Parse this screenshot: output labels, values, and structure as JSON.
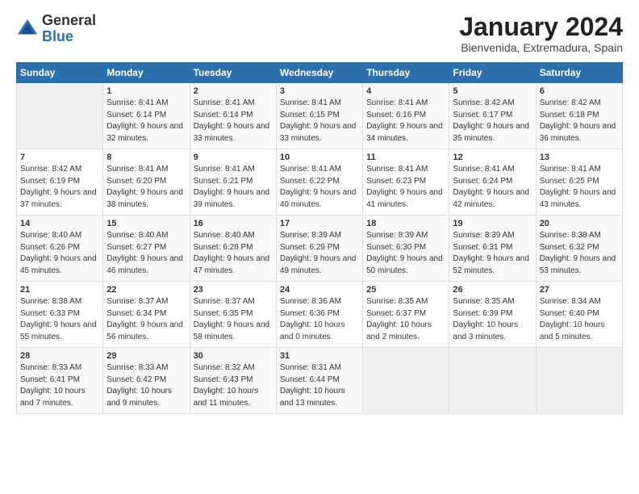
{
  "logo": {
    "general": "General",
    "blue": "Blue"
  },
  "header": {
    "title": "January 2024",
    "subtitle": "Bienvenida, Extremadura, Spain"
  },
  "days_of_week": [
    "Sunday",
    "Monday",
    "Tuesday",
    "Wednesday",
    "Thursday",
    "Friday",
    "Saturday"
  ],
  "weeks": [
    [
      {
        "day": "",
        "sunrise": "",
        "sunset": "",
        "daylight": ""
      },
      {
        "day": "1",
        "sunrise": "Sunrise: 8:41 AM",
        "sunset": "Sunset: 6:14 PM",
        "daylight": "Daylight: 9 hours and 32 minutes."
      },
      {
        "day": "2",
        "sunrise": "Sunrise: 8:41 AM",
        "sunset": "Sunset: 6:14 PM",
        "daylight": "Daylight: 9 hours and 33 minutes."
      },
      {
        "day": "3",
        "sunrise": "Sunrise: 8:41 AM",
        "sunset": "Sunset: 6:15 PM",
        "daylight": "Daylight: 9 hours and 33 minutes."
      },
      {
        "day": "4",
        "sunrise": "Sunrise: 8:41 AM",
        "sunset": "Sunset: 6:16 PM",
        "daylight": "Daylight: 9 hours and 34 minutes."
      },
      {
        "day": "5",
        "sunrise": "Sunrise: 8:42 AM",
        "sunset": "Sunset: 6:17 PM",
        "daylight": "Daylight: 9 hours and 35 minutes."
      },
      {
        "day": "6",
        "sunrise": "Sunrise: 8:42 AM",
        "sunset": "Sunset: 6:18 PM",
        "daylight": "Daylight: 9 hours and 36 minutes."
      }
    ],
    [
      {
        "day": "7",
        "sunrise": "Sunrise: 8:42 AM",
        "sunset": "Sunset: 6:19 PM",
        "daylight": "Daylight: 9 hours and 37 minutes."
      },
      {
        "day": "8",
        "sunrise": "Sunrise: 8:41 AM",
        "sunset": "Sunset: 6:20 PM",
        "daylight": "Daylight: 9 hours and 38 minutes."
      },
      {
        "day": "9",
        "sunrise": "Sunrise: 8:41 AM",
        "sunset": "Sunset: 6:21 PM",
        "daylight": "Daylight: 9 hours and 39 minutes."
      },
      {
        "day": "10",
        "sunrise": "Sunrise: 8:41 AM",
        "sunset": "Sunset: 6:22 PM",
        "daylight": "Daylight: 9 hours and 40 minutes."
      },
      {
        "day": "11",
        "sunrise": "Sunrise: 8:41 AM",
        "sunset": "Sunset: 6:23 PM",
        "daylight": "Daylight: 9 hours and 41 minutes."
      },
      {
        "day": "12",
        "sunrise": "Sunrise: 8:41 AM",
        "sunset": "Sunset: 6:24 PM",
        "daylight": "Daylight: 9 hours and 42 minutes."
      },
      {
        "day": "13",
        "sunrise": "Sunrise: 8:41 AM",
        "sunset": "Sunset: 6:25 PM",
        "daylight": "Daylight: 9 hours and 43 minutes."
      }
    ],
    [
      {
        "day": "14",
        "sunrise": "Sunrise: 8:40 AM",
        "sunset": "Sunset: 6:26 PM",
        "daylight": "Daylight: 9 hours and 45 minutes."
      },
      {
        "day": "15",
        "sunrise": "Sunrise: 8:40 AM",
        "sunset": "Sunset: 6:27 PM",
        "daylight": "Daylight: 9 hours and 46 minutes."
      },
      {
        "day": "16",
        "sunrise": "Sunrise: 8:40 AM",
        "sunset": "Sunset: 6:28 PM",
        "daylight": "Daylight: 9 hours and 47 minutes."
      },
      {
        "day": "17",
        "sunrise": "Sunrise: 8:39 AM",
        "sunset": "Sunset: 6:29 PM",
        "daylight": "Daylight: 9 hours and 49 minutes."
      },
      {
        "day": "18",
        "sunrise": "Sunrise: 8:39 AM",
        "sunset": "Sunset: 6:30 PM",
        "daylight": "Daylight: 9 hours and 50 minutes."
      },
      {
        "day": "19",
        "sunrise": "Sunrise: 8:39 AM",
        "sunset": "Sunset: 6:31 PM",
        "daylight": "Daylight: 9 hours and 52 minutes."
      },
      {
        "day": "20",
        "sunrise": "Sunrise: 8:38 AM",
        "sunset": "Sunset: 6:32 PM",
        "daylight": "Daylight: 9 hours and 53 minutes."
      }
    ],
    [
      {
        "day": "21",
        "sunrise": "Sunrise: 8:38 AM",
        "sunset": "Sunset: 6:33 PM",
        "daylight": "Daylight: 9 hours and 55 minutes."
      },
      {
        "day": "22",
        "sunrise": "Sunrise: 8:37 AM",
        "sunset": "Sunset: 6:34 PM",
        "daylight": "Daylight: 9 hours and 56 minutes."
      },
      {
        "day": "23",
        "sunrise": "Sunrise: 8:37 AM",
        "sunset": "Sunset: 6:35 PM",
        "daylight": "Daylight: 9 hours and 58 minutes."
      },
      {
        "day": "24",
        "sunrise": "Sunrise: 8:36 AM",
        "sunset": "Sunset: 6:36 PM",
        "daylight": "Daylight: 10 hours and 0 minutes."
      },
      {
        "day": "25",
        "sunrise": "Sunrise: 8:35 AM",
        "sunset": "Sunset: 6:37 PM",
        "daylight": "Daylight: 10 hours and 2 minutes."
      },
      {
        "day": "26",
        "sunrise": "Sunrise: 8:35 AM",
        "sunset": "Sunset: 6:39 PM",
        "daylight": "Daylight: 10 hours and 3 minutes."
      },
      {
        "day": "27",
        "sunrise": "Sunrise: 8:34 AM",
        "sunset": "Sunset: 6:40 PM",
        "daylight": "Daylight: 10 hours and 5 minutes."
      }
    ],
    [
      {
        "day": "28",
        "sunrise": "Sunrise: 8:33 AM",
        "sunset": "Sunset: 6:41 PM",
        "daylight": "Daylight: 10 hours and 7 minutes."
      },
      {
        "day": "29",
        "sunrise": "Sunrise: 8:33 AM",
        "sunset": "Sunset: 6:42 PM",
        "daylight": "Daylight: 10 hours and 9 minutes."
      },
      {
        "day": "30",
        "sunrise": "Sunrise: 8:32 AM",
        "sunset": "Sunset: 6:43 PM",
        "daylight": "Daylight: 10 hours and 11 minutes."
      },
      {
        "day": "31",
        "sunrise": "Sunrise: 8:31 AM",
        "sunset": "Sunset: 6:44 PM",
        "daylight": "Daylight: 10 hours and 13 minutes."
      },
      {
        "day": "",
        "sunrise": "",
        "sunset": "",
        "daylight": ""
      },
      {
        "day": "",
        "sunrise": "",
        "sunset": "",
        "daylight": ""
      },
      {
        "day": "",
        "sunrise": "",
        "sunset": "",
        "daylight": ""
      }
    ]
  ]
}
